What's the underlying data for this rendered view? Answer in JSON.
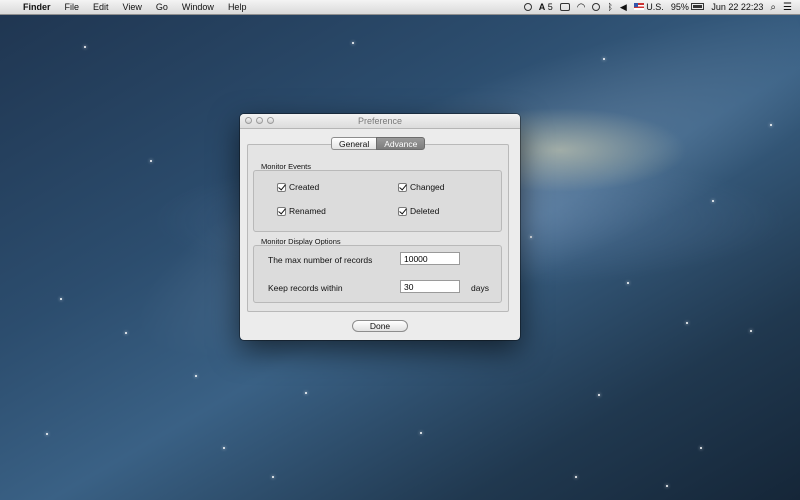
{
  "menubar": {
    "app_name": "Finder",
    "menus": [
      "File",
      "Edit",
      "View",
      "Go",
      "Window",
      "Help"
    ],
    "status": {
      "adobe_count": "5",
      "input_source": "U.S.",
      "battery_percent": "95%",
      "date": "Jun 22",
      "time": "22:23"
    }
  },
  "window": {
    "title": "Preference",
    "tabs": [
      {
        "label": "General",
        "selected": false
      },
      {
        "label": "Advance",
        "selected": true
      }
    ],
    "monitor_events": {
      "title": "Monitor Events",
      "options": [
        {
          "label": "Created",
          "checked": true
        },
        {
          "label": "Changed",
          "checked": true
        },
        {
          "label": "Renamed",
          "checked": true
        },
        {
          "label": "Deleted",
          "checked": true
        }
      ]
    },
    "display_options": {
      "title": "Monitor Display Options",
      "max_records_label": "The max number of records",
      "max_records_value": "10000",
      "keep_label": "Keep records within",
      "keep_value": "30",
      "keep_unit": "days"
    },
    "done_label": "Done"
  }
}
